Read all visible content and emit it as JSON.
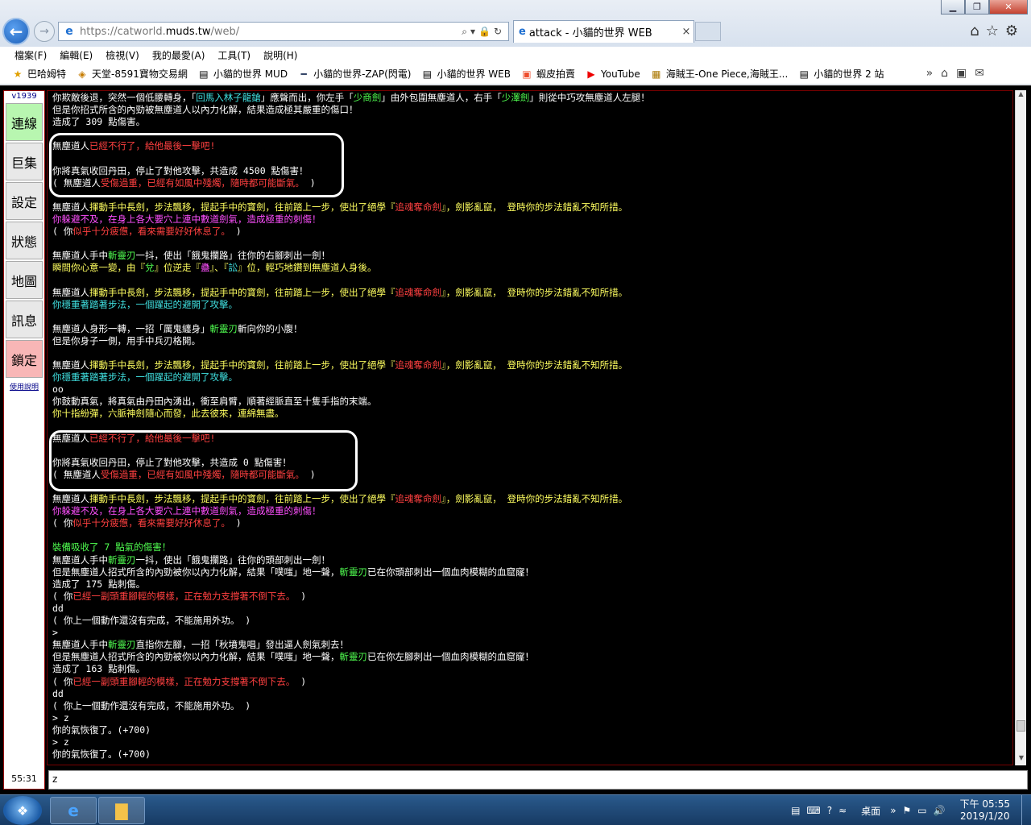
{
  "browser": {
    "url_base": "https://catworld.",
    "url_host": "muds.tw",
    "url_path": "/web/",
    "tab_title": "attack - 小貓的世界 WEB",
    "menu": [
      "檔案(F)",
      "編輯(E)",
      "檢視(V)",
      "我的最愛(A)",
      "工具(T)",
      "說明(H)"
    ],
    "favorites": [
      {
        "icon": "star-icon",
        "label": "巴哈姆特"
      },
      {
        "icon": "page-icon",
        "label": "天堂-8591寶物交易網"
      },
      {
        "icon": "page-icon",
        "label": "小貓的世界 MUD"
      },
      {
        "icon": "page-icon",
        "label": "小貓的世界-ZAP(閃電)"
      },
      {
        "icon": "page-icon",
        "label": "小貓的世界 WEB"
      },
      {
        "icon": "shop-icon",
        "label": "蝦皮拍賣"
      },
      {
        "icon": "youtube-icon",
        "label": "YouTube"
      },
      {
        "icon": "page-icon",
        "label": "海賊王-One Piece,海賊王..."
      },
      {
        "icon": "page-icon",
        "label": "小貓的世界 2 站"
      }
    ]
  },
  "sidebar": {
    "version": "v1939",
    "buttons": [
      "連線",
      "巨集",
      "設定",
      "狀態",
      "地圖",
      "訊息",
      "鎖定"
    ],
    "help": "使用說明",
    "timer": "55:31"
  },
  "output_lines": [
    [
      [
        "w",
        "你欺敵後退，突然一個低腰轉身，「"
      ],
      [
        "c",
        "回馬入林子龍鎗"
      ],
      [
        "w",
        "」應聲而出，你左手「"
      ],
      [
        "g",
        "少商劍"
      ],
      [
        "w",
        "」由外包圍無塵道人，右手「"
      ],
      [
        "g",
        "少澤劍"
      ],
      [
        "w",
        "」則從中巧攻無塵道人左腿！"
      ]
    ],
    [
      [
        "w",
        "但是你招式所含的內勁被無塵道人以內力化解，結果造成極其嚴重的傷口！"
      ]
    ],
    [
      [
        "w",
        "造成了 309 點傷害。"
      ]
    ],
    [],
    [
      [
        "w",
        "無塵道人"
      ],
      [
        "r",
        "已經不行了，給他最後一擊吧!"
      ]
    ],
    [],
    [
      [
        "w",
        "你將真氣收回丹田，停止了對他攻擊，共造成 4500 點傷害！"
      ]
    ],
    [
      [
        "w",
        "( 無塵道人"
      ],
      [
        "r",
        "受傷過重，已經有如風中殘燭，隨時都可能斷氣。"
      ],
      [
        "w",
        " )"
      ]
    ],
    [],
    [
      [
        "w",
        "無塵道人"
      ],
      [
        "y",
        "揮動手中長劍，步法飄移，提起手中的寶劍，往前踏上一步，使出了絕學『"
      ],
      [
        "r",
        "追魂奪命劍"
      ],
      [
        "y",
        "』，劍影亂竄， 登時你的步法錯亂不知所措。"
      ]
    ],
    [
      [
        "m",
        "你躲避不及，在身上各大要穴上連中數道劍氣，造成極重的刺傷！"
      ]
    ],
    [
      [
        "w",
        "( 你"
      ],
      [
        "r",
        "似乎十分疲憊，看來需要好好休息了。"
      ],
      [
        "w",
        " )"
      ]
    ],
    [],
    [
      [
        "w",
        "無塵道人手中"
      ],
      [
        "g",
        "斬靈刃"
      ],
      [
        "w",
        "一抖，使出「餓鬼攔路」往你的右腳刺出一劍！"
      ]
    ],
    [
      [
        "y",
        "瞬間你心意一變，由『"
      ],
      [
        "g",
        "兌"
      ],
      [
        "y",
        "』位逆走『"
      ],
      [
        "m",
        "蠱"
      ],
      [
        "y",
        "』、『"
      ],
      [
        "c",
        "訟"
      ],
      [
        "y",
        "』位，輕巧地鑽到無塵道人身後。"
      ]
    ],
    [],
    [
      [
        "w",
        "無塵道人"
      ],
      [
        "y",
        "揮動手中長劍，步法飄移，提起手中的寶劍，往前踏上一步，使出了絕學『"
      ],
      [
        "r",
        "追魂奪命劍"
      ],
      [
        "y",
        "』，劍影亂竄， 登時你的步法錯亂不知所措。"
      ]
    ],
    [
      [
        "c",
        "你穩重著踏著步法，一個躍起的避開了攻擊。"
      ]
    ],
    [],
    [
      [
        "w",
        "無塵道人身形一轉，一招「厲鬼纏身」"
      ],
      [
        "g",
        "斬靈刃"
      ],
      [
        "w",
        "斬向你的小腹！"
      ]
    ],
    [
      [
        "w",
        "但是你身子一側，用手中兵刃格開。"
      ]
    ],
    [],
    [
      [
        "w",
        "無塵道人"
      ],
      [
        "y",
        "揮動手中長劍，步法飄移，提起手中的寶劍，往前踏上一步，使出了絕學『"
      ],
      [
        "r",
        "追魂奪命劍"
      ],
      [
        "y",
        "』，劍影亂竄， 登時你的步法錯亂不知所措。"
      ]
    ],
    [
      [
        "c",
        "你穩重著踏著步法，一個躍起的避開了攻擊。"
      ]
    ],
    [
      [
        "w",
        "oo"
      ]
    ],
    [
      [
        "w",
        "你鼓動真氣，將真氣由丹田內湧出，衝至肩臂，順著經脈直至十隻手指的末端。"
      ]
    ],
    [
      [
        "y",
        "你十指紛彈，六脈神劍隨心而發，此去彼來，連綿無盡。"
      ]
    ],
    [],
    [
      [
        "w",
        "無塵道人"
      ],
      [
        "r",
        "已經不行了，給他最後一擊吧!"
      ]
    ],
    [],
    [
      [
        "w",
        "你將真氣收回丹田，停止了對他攻擊，共造成 0 點傷害！"
      ]
    ],
    [
      [
        "w",
        "( 無塵道人"
      ],
      [
        "r",
        "受傷過重，已經有如風中殘燭，隨時都可能斷氣。"
      ],
      [
        "w",
        " )"
      ]
    ],
    [],
    [
      [
        "w",
        "無塵道人"
      ],
      [
        "y",
        "揮動手中長劍，步法飄移，提起手中的寶劍，往前踏上一步，使出了絕學『"
      ],
      [
        "r",
        "追魂奪命劍"
      ],
      [
        "y",
        "』，劍影亂竄， 登時你的步法錯亂不知所措。"
      ]
    ],
    [
      [
        "m",
        "你躲避不及，在身上各大要穴上連中數道劍氣，造成極重的刺傷！"
      ]
    ],
    [
      [
        "w",
        "( 你"
      ],
      [
        "r",
        "似乎十分疲憊，看來需要好好休息了。"
      ],
      [
        "w",
        " )"
      ]
    ],
    [],
    [
      [
        "g",
        "裝備吸收了 7 點氣的傷害！"
      ]
    ],
    [
      [
        "w",
        "無塵道人手中"
      ],
      [
        "g",
        "斬靈刃"
      ],
      [
        "w",
        "一抖，使出「餓鬼攔路」往你的頭部刺出一劍！"
      ]
    ],
    [
      [
        "w",
        "但是無塵道人招式所含的內勁被你以內力化解，結果「噗嗤」地一聲，"
      ],
      [
        "g",
        "斬靈刃"
      ],
      [
        "w",
        "已在你頭部刺出一個血肉模糊的血窟窿！"
      ]
    ],
    [
      [
        "w",
        "造成了 175 點刺傷。"
      ]
    ],
    [
      [
        "w",
        "( 你"
      ],
      [
        "r",
        "已經一副頭重腳輕的模樣，正在勉力支撐著不倒下去。"
      ],
      [
        "w",
        " )"
      ]
    ],
    [
      [
        "w",
        "dd"
      ]
    ],
    [
      [
        "w",
        "( 你上一個動作還沒有完成，不能施用外功。 )"
      ]
    ],
    [
      [
        "w",
        ">"
      ]
    ],
    [
      [
        "w",
        "無塵道人手中"
      ],
      [
        "g",
        "斬靈刃"
      ],
      [
        "w",
        "直指你左腳，一招「秋墳鬼唱」發出逼人劍氣刺去！"
      ]
    ],
    [
      [
        "w",
        "但是無塵道人招式所含的內勁被你以內力化解，結果「噗嗤」地一聲，"
      ],
      [
        "g",
        "斬靈刃"
      ],
      [
        "w",
        "已在你左腳刺出一個血肉模糊的血窟窿！"
      ]
    ],
    [
      [
        "w",
        "造成了 163 點刺傷。"
      ]
    ],
    [
      [
        "w",
        "( 你"
      ],
      [
        "r",
        "已經一副頭重腳輕的模樣，正在勉力支撐著不倒下去。"
      ],
      [
        "w",
        " )"
      ]
    ],
    [
      [
        "w",
        "dd"
      ]
    ],
    [
      [
        "w",
        "( 你上一個動作還沒有完成，不能施用外功。 )"
      ]
    ],
    [
      [
        "w",
        "> z"
      ]
    ],
    [
      [
        "w",
        "你的氣恢復了。(+700)"
      ]
    ],
    [
      [
        "w",
        "> z"
      ]
    ],
    [
      [
        "w",
        "你的氣恢復了。(+700)"
      ]
    ]
  ],
  "input": {
    "value": "z"
  },
  "taskbar": {
    "desktop": "桌面",
    "time": "下午 05:55",
    "date": "2019/1/20"
  },
  "colors": {
    "terminal_bg": "#000000",
    "accent_red": "#ff4040",
    "accent_yellow": "#ffff60",
    "accent_green": "#50ff50"
  }
}
